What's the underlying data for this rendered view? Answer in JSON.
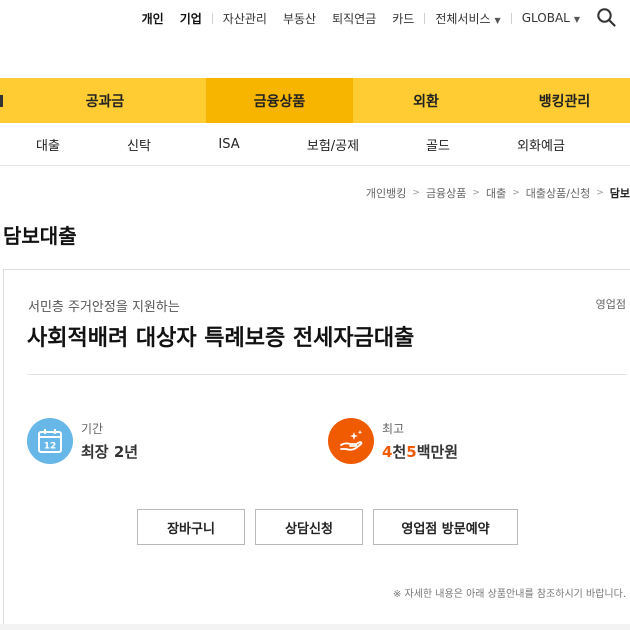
{
  "topbar": {
    "personal": "개인",
    "corporate": "기업",
    "asset": "자산관리",
    "realestate": "부동산",
    "pension": "퇴직연금",
    "card": "카드",
    "all_services": "전체서비스",
    "global": "GLOBAL",
    "search_icon": "search-icon"
  },
  "mainnav": {
    "items": [
      {
        "label": "공과금"
      },
      {
        "label": "금융상품",
        "active": true
      },
      {
        "label": "외환"
      },
      {
        "label": "뱅킹관리"
      }
    ]
  },
  "subnav": {
    "items": [
      {
        "label": "대출"
      },
      {
        "label": "신탁"
      },
      {
        "label": "ISA"
      },
      {
        "label": "보험/공제"
      },
      {
        "label": "골드"
      },
      {
        "label": "외화예금"
      }
    ]
  },
  "breadcrumb": {
    "items": [
      "개인뱅킹",
      "금융상품",
      "대출",
      "대출상품/신청"
    ],
    "current": "담보"
  },
  "page": {
    "title": "담보대출"
  },
  "product": {
    "subtitle": "서민층 주거안정을 지원하는",
    "badge": "영업점",
    "title": "사회적배려 대상자 특례보증 전세자금대출",
    "period": {
      "label": "기간",
      "value": "최장 2년",
      "icon": "calendar-icon",
      "icon_number": "12"
    },
    "max": {
      "label": "최고",
      "num1": "4",
      "unit1": "천",
      "num2": "5",
      "unit2": "백만원",
      "icon": "hand-sparkle-icon"
    },
    "buttons": {
      "cart": "장바구니",
      "consult": "상담신청",
      "visit": "영업점 방문예약"
    },
    "note": "※ 자세한 내용은 아래 상품안내를 참조하시기 바랍니다."
  },
  "colors": {
    "nav_yellow": "#ffcc33",
    "nav_active": "#f8b500",
    "accent_orange": "#f05a00",
    "period_blue": "#67b7e8"
  }
}
